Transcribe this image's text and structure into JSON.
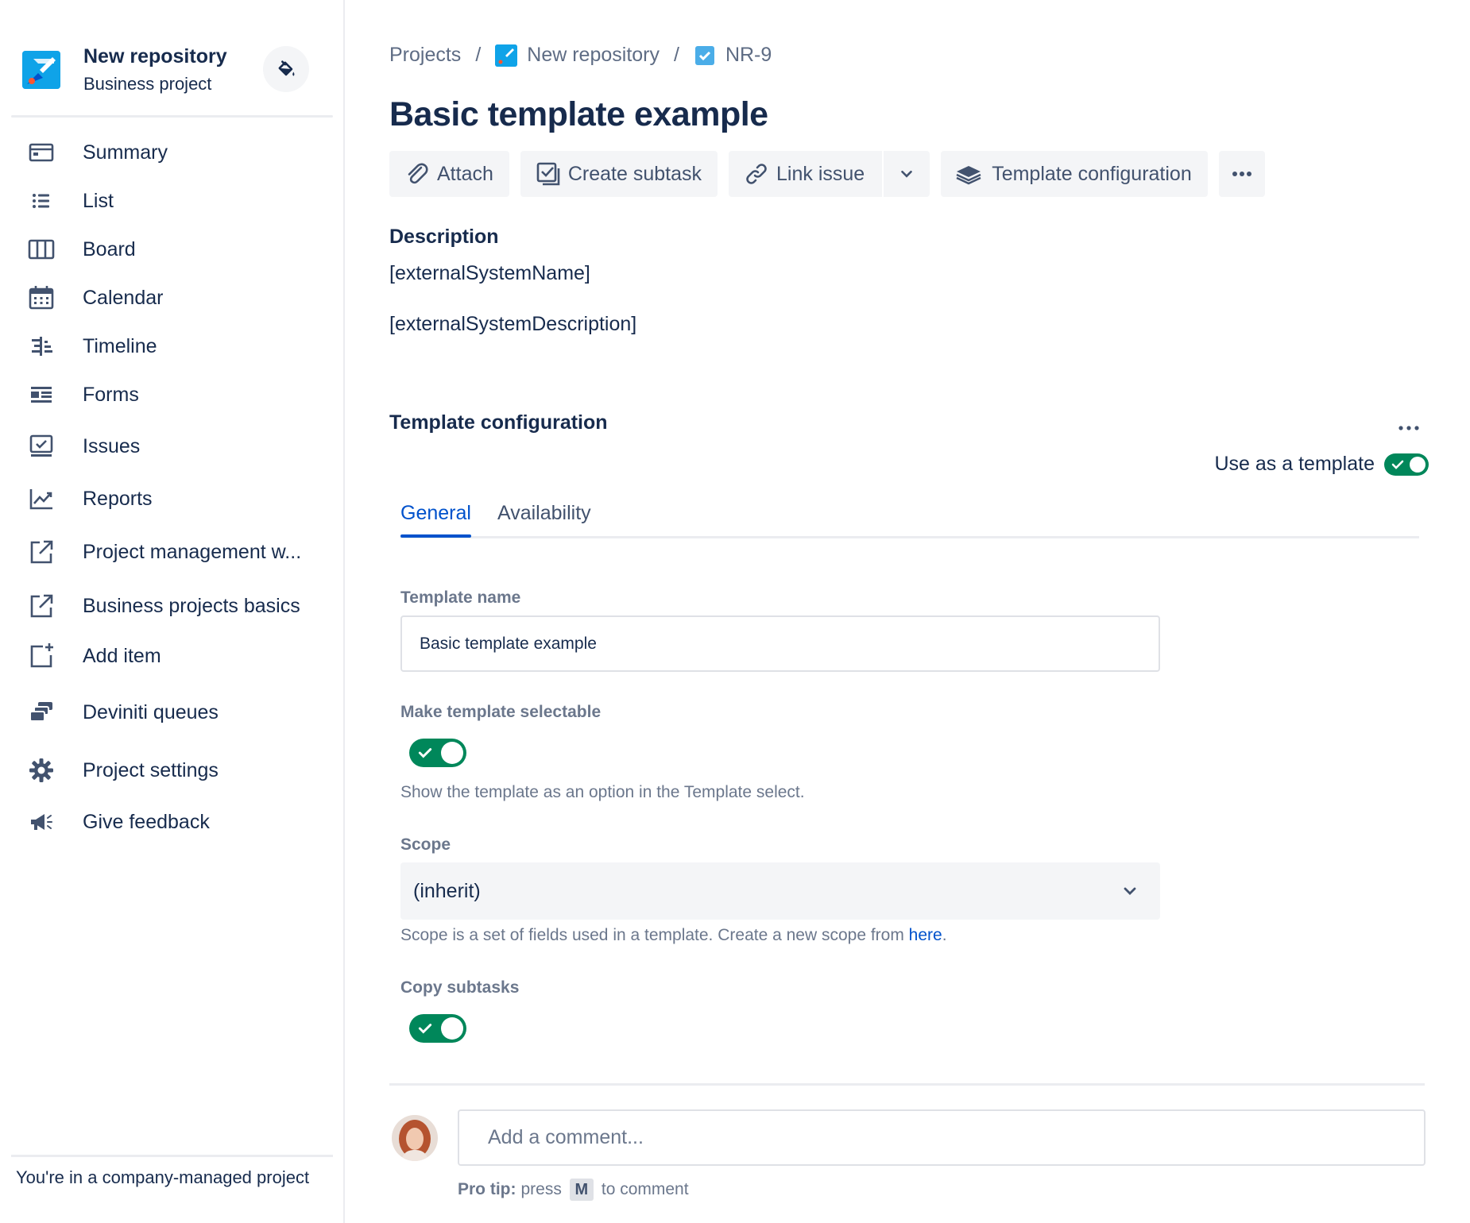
{
  "sidebar": {
    "project_name": "New repository",
    "project_type": "Business project",
    "items": [
      {
        "label": "Summary",
        "icon": "summary-icon"
      },
      {
        "label": "List",
        "icon": "list-icon"
      },
      {
        "label": "Board",
        "icon": "board-icon"
      },
      {
        "label": "Calendar",
        "icon": "calendar-icon"
      },
      {
        "label": "Timeline",
        "icon": "timeline-icon"
      },
      {
        "label": "Forms",
        "icon": "forms-icon"
      },
      {
        "label": "Issues",
        "icon": "issues-icon"
      },
      {
        "label": "Reports",
        "icon": "reports-icon"
      },
      {
        "label": "Project management w...",
        "icon": "external-link-icon"
      },
      {
        "label": "Business projects basics",
        "icon": "external-link-icon"
      },
      {
        "label": "Add item",
        "icon": "add-item-icon"
      },
      {
        "label": "Deviniti queues",
        "icon": "queues-icon"
      },
      {
        "label": "Project settings",
        "icon": "gear-icon"
      },
      {
        "label": "Give feedback",
        "icon": "megaphone-icon"
      }
    ],
    "footer": "You're in a company-managed project"
  },
  "breadcrumb": {
    "projects": "Projects",
    "project": "New repository",
    "issue_key": "NR-9"
  },
  "issue": {
    "title": "Basic template example"
  },
  "toolbar": {
    "attach": "Attach",
    "create_subtask": "Create subtask",
    "link_issue": "Link issue",
    "template_configuration": "Template configuration"
  },
  "description": {
    "heading": "Description",
    "lines": [
      "[externalSystemName]",
      "[externalSystemDescription]"
    ]
  },
  "template_config": {
    "heading": "Template configuration",
    "use_as_template_label": "Use as a template",
    "use_as_template": true,
    "tabs": [
      "General",
      "Availability"
    ],
    "active_tab": "General",
    "template_name_label": "Template name",
    "template_name_value": "Basic template example",
    "selectable_label": "Make template selectable",
    "selectable": true,
    "selectable_help": "Show the template as an option in the Template select.",
    "scope_label": "Scope",
    "scope_value": "(inherit)",
    "scope_help_prefix": "Scope is a set of fields used in a template. Create a new scope from ",
    "scope_help_link": "here",
    "scope_help_suffix": ".",
    "copy_subtasks_label": "Copy subtasks",
    "copy_subtasks": true
  },
  "comment": {
    "placeholder": "Add a comment...",
    "protip_bold": "Pro tip:",
    "protip_press": "press",
    "protip_key": "M",
    "protip_suffix": "to comment"
  },
  "colors": {
    "accent": "#0052cc",
    "toggle_on": "#00875a",
    "text": "#172b4d",
    "subtle_text": "#6b778c"
  }
}
